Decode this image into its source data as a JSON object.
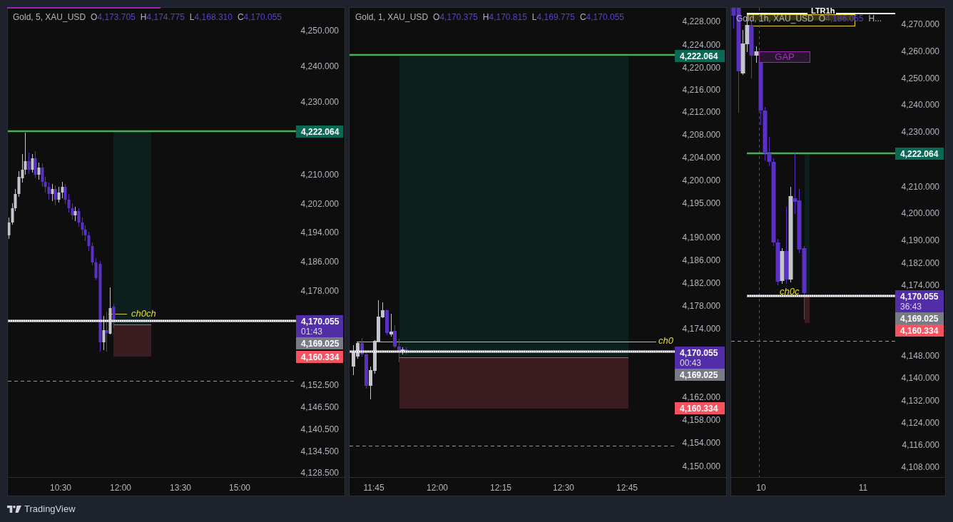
{
  "panes": [
    {
      "legend": {
        "title": "Gold, 5, XAU_USD",
        "fields": [
          {
            "key": "O",
            "value": "4,173.705"
          },
          {
            "key": "H",
            "value": "4,174.775"
          },
          {
            "key": "L",
            "value": "4,168.310"
          },
          {
            "key": "C",
            "value": "4,170.055"
          }
        ]
      },
      "price_axis": [
        "4,250.000",
        "4,240.000",
        "4,230.000",
        "4,210.000",
        "4,202.000",
        "4,194.000",
        "4,186.000",
        "4,178.000",
        "4,152.500",
        "4,146.500",
        "4,140.500",
        "4,134.500",
        "4,128.500"
      ],
      "time_axis": [
        "10:30",
        "12:00",
        "13:30",
        "15:00"
      ],
      "price_tags": [
        {
          "kind": "take_profit",
          "color": "#0a6955",
          "price": "4,222.064"
        },
        {
          "kind": "last",
          "color": "#512da8",
          "price": "4,170.055",
          "countdown": "01:43"
        },
        {
          "kind": "entry",
          "color": "#787b86",
          "price": "4,169.025"
        },
        {
          "kind": "stop_loss",
          "color": "#f7525f",
          "price": "4,160.334"
        }
      ],
      "labels": [
        {
          "kind": "choch",
          "text": "ch0ch"
        }
      ]
    },
    {
      "legend": {
        "title": "Gold, 1, XAU_USD",
        "fields": [
          {
            "key": "O",
            "value": "4,170.375"
          },
          {
            "key": "H",
            "value": "4,170.815"
          },
          {
            "key": "L",
            "value": "4,169.775"
          },
          {
            "key": "C",
            "value": "4,170.055"
          }
        ]
      },
      "price_axis": [
        "4,228.000",
        "4,224.000",
        "4,220.000",
        "4,216.000",
        "4,212.000",
        "4,208.000",
        "4,204.000",
        "4,200.000",
        "4,195.000",
        "4,190.000",
        "4,186.000",
        "4,182.000",
        "4,178.000",
        "4,174.000",
        "4,162.000",
        "4,158.000",
        "4,154.000",
        "4,150.000"
      ],
      "time_axis": [
        "11:45",
        "12:00",
        "12:15",
        "12:30",
        "12:45"
      ],
      "price_tags": [
        {
          "kind": "take_profit",
          "color": "#0a6955",
          "price": "4,222.064"
        },
        {
          "kind": "last",
          "color": "#512da8",
          "price": "4,170.055",
          "countdown": "00:43"
        },
        {
          "kind": "entry",
          "color": "#787b86",
          "price": "4,169.025"
        },
        {
          "kind": "stop_loss",
          "color": "#f7525f",
          "price": "4,160.334"
        }
      ],
      "labels": [
        {
          "kind": "choch",
          "text": "ch0"
        }
      ]
    },
    {
      "legend": {
        "title": "Gold, 1h, XAU_USD",
        "fields": [
          {
            "key": "O",
            "value": "4,186.065"
          }
        ],
        "overflow": "H..."
      },
      "price_axis": [
        "4,270.000",
        "4,260.000",
        "4,250.000",
        "4,240.000",
        "4,230.000",
        "4,210.000",
        "4,200.000",
        "4,190.000",
        "4,182.000",
        "4,174.000",
        "4,148.000",
        "4,140.000",
        "4,132.000",
        "4,124.000",
        "4,116.000",
        "4,108.000"
      ],
      "time_axis": [
        "10",
        "11"
      ],
      "price_tags": [
        {
          "kind": "take_profit",
          "color": "#0a6955",
          "price": "4,222.064"
        },
        {
          "kind": "last",
          "color": "#512da8",
          "price": "4,170.055",
          "countdown": "36:43"
        },
        {
          "kind": "entry",
          "color": "#787b86",
          "price": "4,169.025"
        },
        {
          "kind": "stop_loss",
          "color": "#f7525f",
          "price": "4,160.334"
        }
      ],
      "labels": [
        {
          "kind": "ltr",
          "text": "LTR1h"
        },
        {
          "kind": "gap",
          "text": "GAP"
        },
        {
          "kind": "choch",
          "text": "ch0c"
        }
      ]
    }
  ],
  "footer": {
    "brand": "TradingView"
  }
}
